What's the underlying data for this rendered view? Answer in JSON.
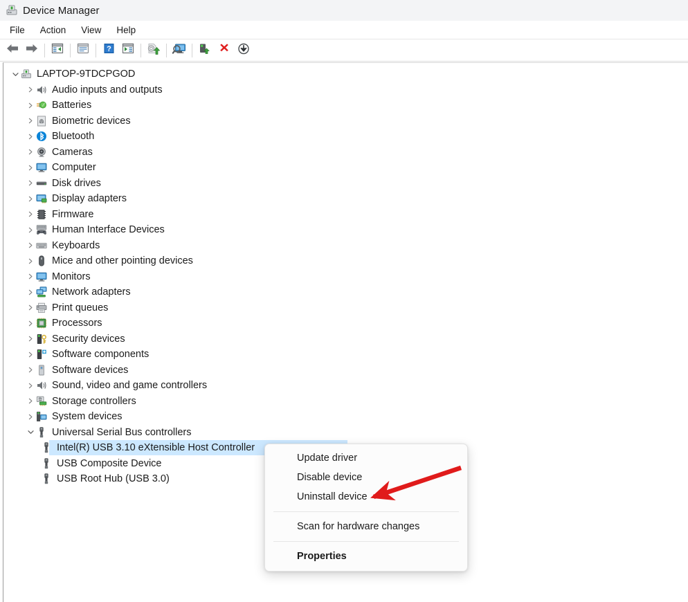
{
  "window": {
    "title": "Device Manager",
    "icon": "device-manager-icon"
  },
  "menubar": {
    "items": [
      {
        "label": "File"
      },
      {
        "label": "Action"
      },
      {
        "label": "View"
      },
      {
        "label": "Help"
      }
    ]
  },
  "toolbar": {
    "buttons": [
      {
        "icon": "back-arrow-icon",
        "tooltip": "Back"
      },
      {
        "icon": "forward-arrow-icon",
        "tooltip": "Forward"
      },
      {
        "icon": "show-hide-console-tree-icon",
        "tooltip": "Show/Hide Console Tree"
      },
      {
        "icon": "properties-icon",
        "tooltip": "Properties"
      },
      {
        "icon": "help-icon",
        "tooltip": "Help"
      },
      {
        "icon": "show-hide-action-pane-icon",
        "tooltip": "Show/Hide Action Pane"
      },
      {
        "icon": "update-driver-icon",
        "tooltip": "Update driver"
      },
      {
        "icon": "scan-hardware-changes-icon",
        "tooltip": "Scan for hardware changes"
      },
      {
        "icon": "enable-device-icon",
        "tooltip": "Enable device"
      },
      {
        "icon": "uninstall-device-icon",
        "tooltip": "Uninstall device"
      },
      {
        "icon": "install-legacy-driver-icon",
        "tooltip": "Add legacy hardware"
      }
    ]
  },
  "tree": {
    "root": {
      "label": "LAPTOP-9TDCPGOD",
      "icon": "computer-root-icon",
      "expanded": true,
      "depth": 0
    },
    "nodes": [
      {
        "label": "Audio inputs and outputs",
        "icon": "speaker-icon",
        "expanded": false,
        "depth": 1
      },
      {
        "label": "Batteries",
        "icon": "battery-icon",
        "expanded": false,
        "depth": 1
      },
      {
        "label": "Biometric devices",
        "icon": "fingerprint-icon",
        "expanded": false,
        "depth": 1
      },
      {
        "label": "Bluetooth",
        "icon": "bluetooth-icon",
        "expanded": false,
        "depth": 1
      },
      {
        "label": "Cameras",
        "icon": "camera-icon",
        "expanded": false,
        "depth": 1
      },
      {
        "label": "Computer",
        "icon": "monitor-icon",
        "expanded": false,
        "depth": 1
      },
      {
        "label": "Disk drives",
        "icon": "disk-drive-icon",
        "expanded": false,
        "depth": 1
      },
      {
        "label": "Display adapters",
        "icon": "display-adapter-icon",
        "expanded": false,
        "depth": 1
      },
      {
        "label": "Firmware",
        "icon": "firmware-chip-icon",
        "expanded": false,
        "depth": 1
      },
      {
        "label": "Human Interface Devices",
        "icon": "gamepad-icon",
        "expanded": false,
        "depth": 1
      },
      {
        "label": "Keyboards",
        "icon": "keyboard-icon",
        "expanded": false,
        "depth": 1
      },
      {
        "label": "Mice and other pointing devices",
        "icon": "mouse-icon",
        "expanded": false,
        "depth": 1
      },
      {
        "label": "Monitors",
        "icon": "monitor-icon",
        "expanded": false,
        "depth": 1
      },
      {
        "label": "Network adapters",
        "icon": "network-adapter-icon",
        "expanded": false,
        "depth": 1
      },
      {
        "label": "Print queues",
        "icon": "printer-icon",
        "expanded": false,
        "depth": 1
      },
      {
        "label": "Processors",
        "icon": "processor-chip-icon",
        "expanded": false,
        "depth": 1
      },
      {
        "label": "Security devices",
        "icon": "security-key-icon",
        "expanded": false,
        "depth": 1
      },
      {
        "label": "Software components",
        "icon": "software-component-icon",
        "expanded": false,
        "depth": 1
      },
      {
        "label": "Software devices",
        "icon": "software-device-icon",
        "expanded": false,
        "depth": 1
      },
      {
        "label": "Sound, video and game controllers",
        "icon": "speaker-icon",
        "expanded": false,
        "depth": 1
      },
      {
        "label": "Storage controllers",
        "icon": "storage-controller-icon",
        "expanded": false,
        "depth": 1
      },
      {
        "label": "System devices",
        "icon": "system-device-icon",
        "expanded": false,
        "depth": 1
      },
      {
        "label": "Universal Serial Bus controllers",
        "icon": "usb-icon",
        "expanded": true,
        "depth": 1
      },
      {
        "label": "Intel(R) USB 3.10 eXtensible Host Controller",
        "icon": "usb-icon",
        "expanded": false,
        "depth": 2,
        "selected": true
      },
      {
        "label": "USB Composite Device",
        "icon": "usb-icon",
        "expanded": false,
        "depth": 2
      },
      {
        "label": "USB Root Hub (USB 3.0)",
        "icon": "usb-icon",
        "expanded": false,
        "depth": 2
      }
    ]
  },
  "context_menu": {
    "items": [
      {
        "label": "Update driver",
        "type": "item"
      },
      {
        "label": "Disable device",
        "type": "item"
      },
      {
        "label": "Uninstall device",
        "type": "item"
      },
      {
        "type": "separator"
      },
      {
        "label": "Scan for hardware changes",
        "type": "item"
      },
      {
        "type": "separator"
      },
      {
        "label": "Properties",
        "type": "item",
        "bold": true
      }
    ]
  },
  "annotation": {
    "type": "arrow",
    "color": "#e01b1b",
    "points_to": "Uninstall device"
  },
  "colors": {
    "titlebar_bg": "#f3f4f6",
    "selection_bg": "#cce8ff",
    "annotation_red": "#e01b1b",
    "text": "#1b1b1b"
  }
}
